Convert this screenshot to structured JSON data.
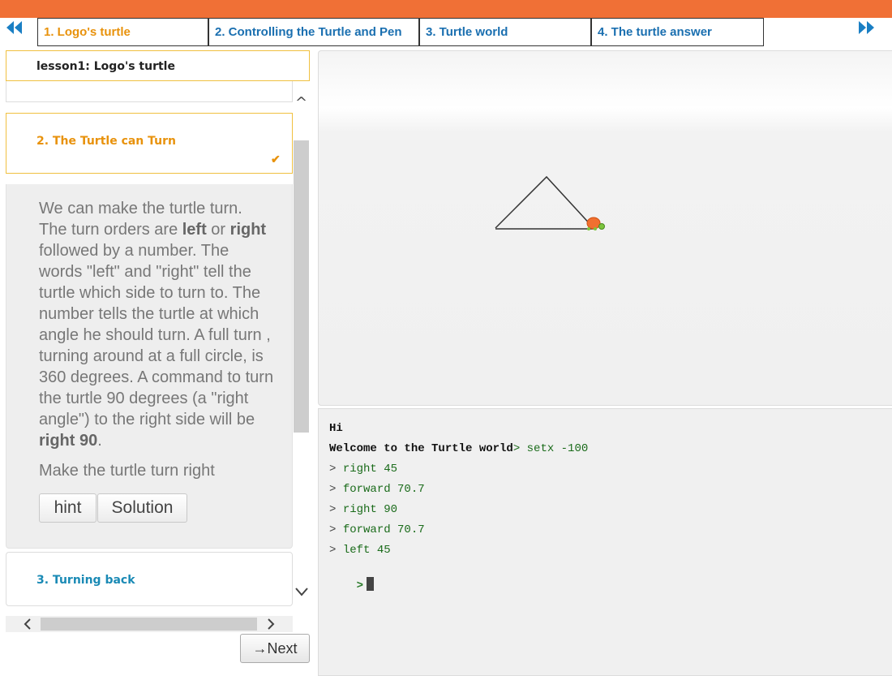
{
  "nav": {
    "prev_icon": "double-chevron-left-icon",
    "next_icon": "double-chevron-right-icon",
    "tabs": [
      {
        "label": "1. Logo's turtle",
        "active": true
      },
      {
        "label": "2. Controlling the Turtle and Pen",
        "active": false
      },
      {
        "label": "3. Turtle world",
        "active": false
      },
      {
        "label": "4. The turtle answer",
        "active": false
      }
    ]
  },
  "lesson": {
    "title": "lesson1: Logo's turtle",
    "section2": {
      "title": "2. The Turtle can Turn",
      "paragraph": [
        {
          "t": "We can make the turtle turn. The turn orders are "
        },
        {
          "b": "left"
        },
        {
          "t": " or "
        },
        {
          "b": "right"
        },
        {
          "t": " followed by a number. The words \"left\" and \"right\" tell the turtle which side to turn to. The number tells the turtle at which angle he should turn. A full turn , turning around at a full circle, is 360 degrees. A command to turn the turtle 90 degrees (a \"right angle\") to the right side will be "
        },
        {
          "b": "right 90"
        },
        {
          "t": "."
        }
      ],
      "prompt": "Make the turtle turn right",
      "hint_label": "hint",
      "solution_label": "Solution"
    },
    "section3": {
      "title": "3. Turning back"
    },
    "next_label": "→Next"
  },
  "console": {
    "lines": [
      {
        "prompt": "",
        "text": "Hi",
        "style": "black"
      },
      {
        "prompt": "",
        "text": "Welcome to the Turtle world",
        "style": "black",
        "suffix_prompt": "> ",
        "suffix": "setx -100"
      },
      {
        "prompt": "> ",
        "text": "right 45"
      },
      {
        "prompt": "> ",
        "text": "forward 70.7"
      },
      {
        "prompt": "> ",
        "text": "right 90"
      },
      {
        "prompt": "> ",
        "text": "forward 70.7"
      },
      {
        "prompt": "> ",
        "text": "left 45"
      }
    ],
    "input_prompt": ">"
  },
  "colors": {
    "top_bar": "#f07036",
    "active_tab": "#e8920c",
    "tab_text": "#1a6fb0",
    "turtle": "#f07030",
    "console_text": "#1a6b1a"
  }
}
